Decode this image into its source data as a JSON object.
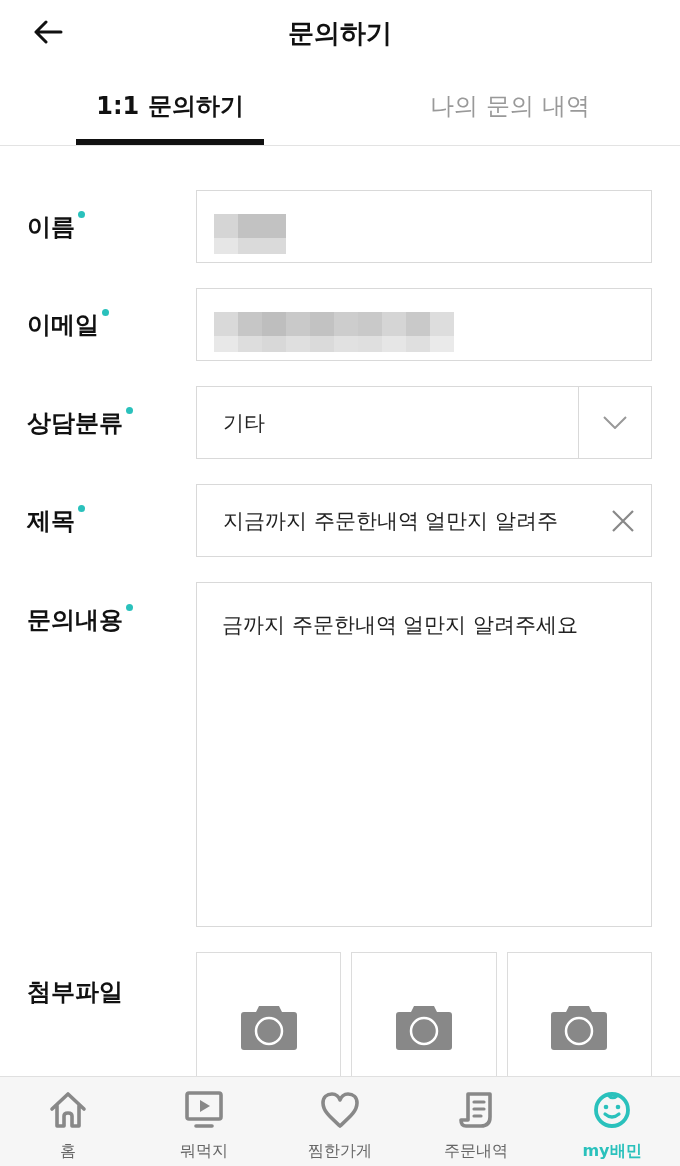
{
  "header": {
    "title": "문의하기"
  },
  "tabs": [
    {
      "label": "1:1 문의하기",
      "selected": true
    },
    {
      "label": "나의 문의 내역",
      "selected": false
    }
  ],
  "form": {
    "fields": [
      {
        "kind": "name",
        "label": "이름",
        "required": true,
        "redacted": true
      },
      {
        "kind": "email",
        "label": "이메일",
        "required": true,
        "redacted": true
      },
      {
        "kind": "select",
        "label": "상담분류",
        "required": true,
        "value": "기타"
      },
      {
        "kind": "clearable",
        "label": "제목",
        "required": true,
        "value": "지금까지 주문한내역 얼만지 알려주"
      },
      {
        "kind": "textarea",
        "label": "문의내용",
        "required": true,
        "value": "금까지 주문한내역 얼만지 알려주세요"
      },
      {
        "kind": "attachments",
        "label": "첨부파일",
        "required": false,
        "slots": [
          {
            "empty": true
          },
          {
            "empty": true
          },
          {
            "empty": true
          }
        ]
      }
    ]
  },
  "nav": [
    {
      "label": "홈",
      "selected": false
    },
    {
      "label": "뭐먹지",
      "selected": false
    },
    {
      "label": "찜한가게",
      "selected": false
    },
    {
      "label": "주문내역",
      "selected": false
    },
    {
      "label": "my배민",
      "selected": true
    }
  ]
}
